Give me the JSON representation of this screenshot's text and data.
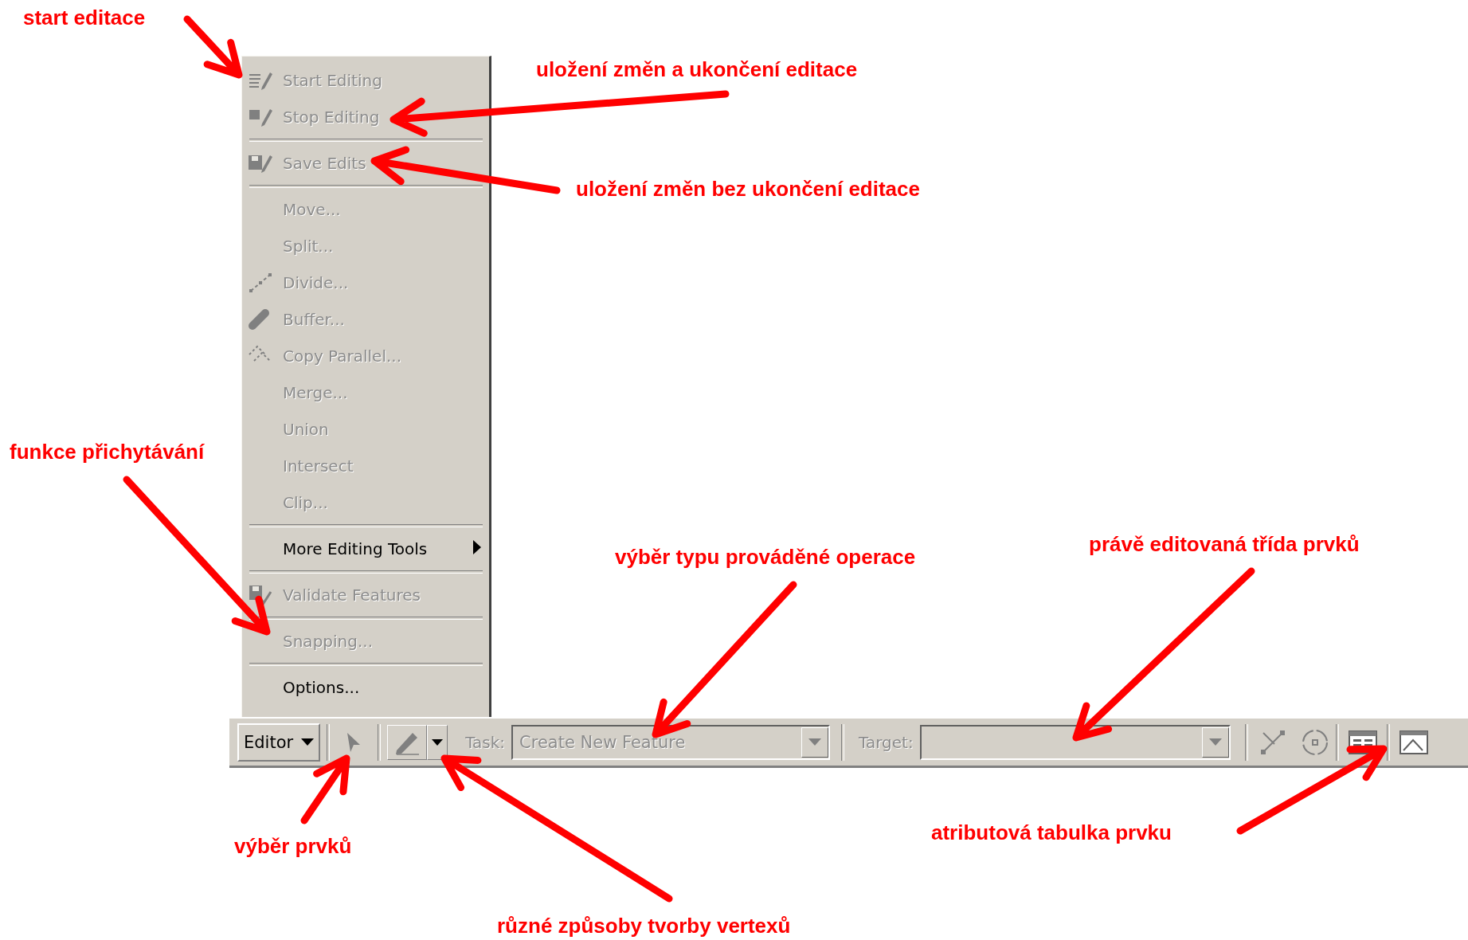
{
  "editor_menu": {
    "items": [
      {
        "kind": "item",
        "label": "Start Editing",
        "disabled": true
      },
      {
        "kind": "item",
        "label": "Stop Editing",
        "disabled": true
      },
      {
        "kind": "separator"
      },
      {
        "kind": "item",
        "label": "Save Edits",
        "disabled": true
      },
      {
        "kind": "separator"
      },
      {
        "kind": "item",
        "label": "Move...",
        "disabled": true
      },
      {
        "kind": "item",
        "label": "Split...",
        "disabled": true
      },
      {
        "kind": "item",
        "label": "Divide...",
        "disabled": true
      },
      {
        "kind": "item",
        "label": "Buffer...",
        "disabled": true
      },
      {
        "kind": "item",
        "label": "Copy Parallel...",
        "disabled": true
      },
      {
        "kind": "item",
        "label": "Merge...",
        "disabled": true
      },
      {
        "kind": "item",
        "label": "Union",
        "disabled": true
      },
      {
        "kind": "item",
        "label": "Intersect",
        "disabled": true
      },
      {
        "kind": "item",
        "label": "Clip...",
        "disabled": true
      },
      {
        "kind": "separator"
      },
      {
        "kind": "submenu",
        "label": "More Editing Tools",
        "disabled": false
      },
      {
        "kind": "separator"
      },
      {
        "kind": "item",
        "label": "Validate Features",
        "disabled": true
      },
      {
        "kind": "separator"
      },
      {
        "kind": "item",
        "label": "Snapping...",
        "disabled": true
      },
      {
        "kind": "separator"
      },
      {
        "kind": "item",
        "label": "Options...",
        "disabled": false
      }
    ]
  },
  "toolbar": {
    "menu_button": "Editor",
    "task": {
      "label": "Task:",
      "value": "Create New Feature",
      "disabled": true
    },
    "target": {
      "label": "Target:",
      "disabled": true
    }
  },
  "annotations": [
    {
      "text": "start editace"
    },
    {
      "text": "uložení změn a ukončení editace"
    },
    {
      "text": "uložení změn bez ukončení editace"
    },
    {
      "text": "funkce přichytávání"
    },
    {
      "text": "výběr typu prováděné operace"
    },
    {
      "text": "právě editovaná třída prvků"
    },
    {
      "text": "výběr prvků"
    },
    {
      "text": "atributová tabulka prvku"
    },
    {
      "text": "různé způsoby tvorby vertexů"
    }
  ]
}
